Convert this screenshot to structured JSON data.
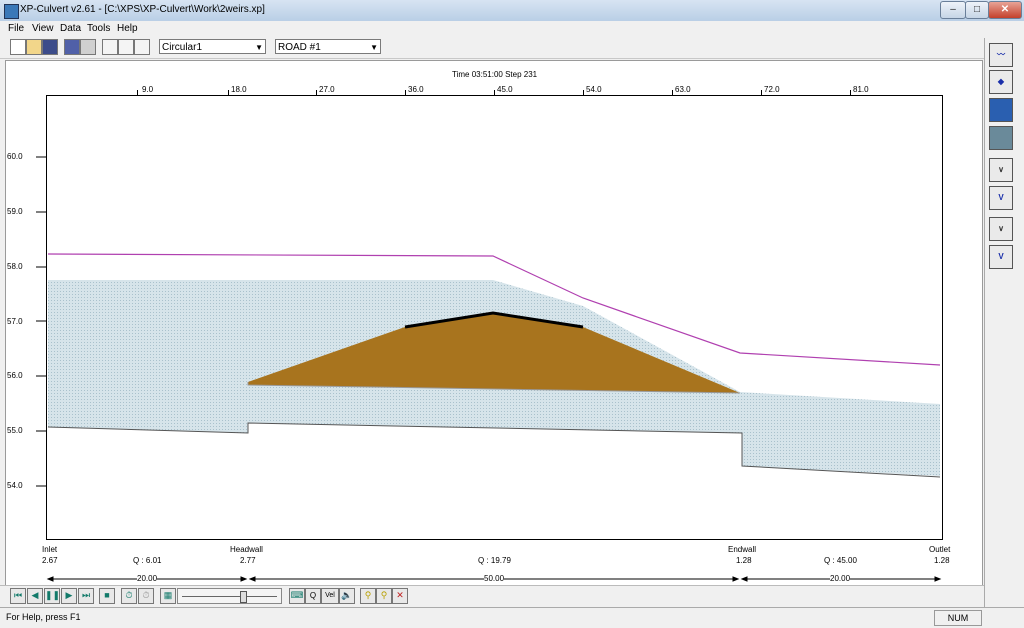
{
  "window": {
    "title": "XP-Culvert v2.61 - [C:\\XPS\\XP-Culvert\\Work\\2weirs.xp]",
    "minimize": "–",
    "maximize": "□",
    "close": "✕"
  },
  "menu": [
    "File",
    "View",
    "Data",
    "Tools",
    "Help"
  ],
  "toolbar": {
    "culvert_select": "Circular1",
    "road_select": "ROAD #1"
  },
  "plot": {
    "time_label": "Time 03:51:00 Step 231",
    "x_ticks": [
      "9.0",
      "18.0",
      "27.0",
      "36.0",
      "45.0",
      "54.0",
      "63.0",
      "72.0",
      "81.0"
    ],
    "y_ticks": [
      "60.0",
      "59.0",
      "58.0",
      "57.0",
      "56.0",
      "55.0",
      "54.0"
    ],
    "colors": {
      "water": "#cfe0e6",
      "embankment": "#a8741e",
      "hgl": "#b040b0",
      "road": "#000000"
    }
  },
  "sections": {
    "inlet_name": "Inlet",
    "inlet_value": "2.67",
    "headwall_name": "Headwall",
    "headwall_value": "2.77",
    "endwall_name": "Endwall",
    "endwall_value": "1.28",
    "outlet_name": "Outlet",
    "outlet_value": "1.28",
    "q1": "Q :  6.01",
    "q2": "Q : 19.79",
    "q3": "Q : 45.00",
    "len1": "20.00",
    "len2": "50.00",
    "len3": "20.00"
  },
  "bottom_toolbar": {
    "q_label": "Q",
    "vel_label": "Vel"
  },
  "status": {
    "help": "For Help, press F1",
    "num": "NUM"
  }
}
